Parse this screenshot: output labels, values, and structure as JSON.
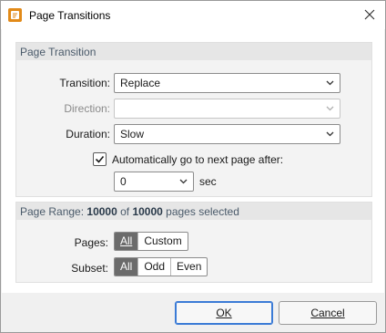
{
  "window": {
    "title": "Page Transitions",
    "icon": "pdf-app-icon",
    "close_icon": "close-icon"
  },
  "transition_group": {
    "header": "Page Transition",
    "transition_label": "Transition:",
    "transition_value": "Replace",
    "direction_label": "Direction:",
    "direction_value": "",
    "duration_label": "Duration:",
    "duration_value": "Slow",
    "auto_advance_label": "Automatically go to next page after:",
    "auto_advance_checked": true,
    "auto_advance_seconds": "0",
    "seconds_unit": "sec"
  },
  "range_group": {
    "header_prefix": "Page Range: ",
    "header_count": "10000",
    "header_of": " of ",
    "header_total": "10000",
    "header_suffix": " pages selected",
    "pages_label": "Pages:",
    "pages_options": [
      "All",
      "Custom"
    ],
    "pages_selected": "All",
    "subset_label": "Subset:",
    "subset_options": [
      "All",
      "Odd",
      "Even"
    ],
    "subset_selected": "All"
  },
  "buttons": {
    "ok": "OK",
    "cancel": "Cancel"
  },
  "colors": {
    "accent": "#3b7bd6",
    "app_icon": "#e28a18",
    "segment_active": "#6b6b6b"
  }
}
